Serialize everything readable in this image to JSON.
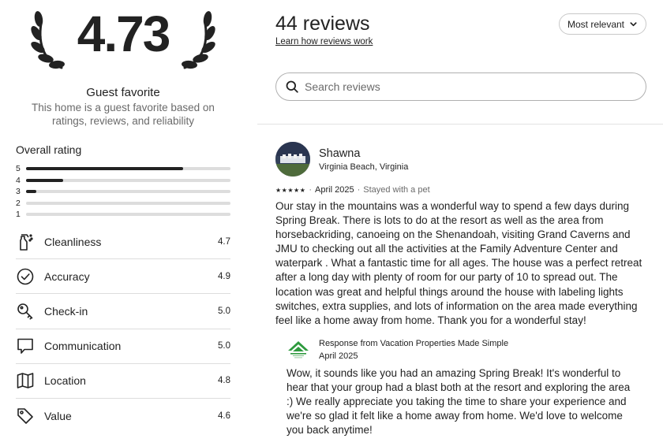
{
  "summary": {
    "overall_score": "4.73",
    "badge_title": "Guest favorite",
    "badge_description": "This home is a guest favorite based on ratings, reviews, and reliability",
    "overall_rating_label": "Overall rating",
    "distribution": [
      {
        "stars": "5",
        "fraction": 0.77
      },
      {
        "stars": "4",
        "fraction": 0.18
      },
      {
        "stars": "3",
        "fraction": 0.05
      },
      {
        "stars": "2",
        "fraction": 0.0
      },
      {
        "stars": "1",
        "fraction": 0.0
      }
    ],
    "categories": [
      {
        "label": "Cleanliness",
        "score": "4.7",
        "icon": "spray-bottle-icon"
      },
      {
        "label": "Accuracy",
        "score": "4.9",
        "icon": "check-circle-icon"
      },
      {
        "label": "Check-in",
        "score": "5.0",
        "icon": "key-icon"
      },
      {
        "label": "Communication",
        "score": "5.0",
        "icon": "chat-bubble-icon"
      },
      {
        "label": "Location",
        "score": "4.8",
        "icon": "map-icon"
      },
      {
        "label": "Value",
        "score": "4.6",
        "icon": "price-tag-icon"
      }
    ]
  },
  "header": {
    "reviews_count": "44 reviews",
    "learn_link": "Learn how reviews work",
    "sort_label": "Most relevant",
    "search_placeholder": "Search reviews"
  },
  "review": {
    "name": "Shawna",
    "location": "Virginia Beach, Virginia",
    "stars": "★★★★★",
    "rating": 5,
    "date": "April 2025",
    "stay_note": "Stayed with a pet",
    "body": "Our stay in the mountains was a wonderful way to spend a few days during Spring Break. There is lots to do at the resort as well as the area from horsebackriding, canoeing on the Shenandoah, visiting Grand Caverns and JMU to checking out all the activities at the Family Adventure Center and waterpark . What a fantastic time for all ages. The house was a perfect retreat after a long day with plenty of room for our party of 10 to spread out. The location was great and helpful things around the house with labeling lights switches, extra supplies, and lots of information on the area made everything feel like a home away from home. Thank you for a wonderful stay!",
    "response": {
      "title": "Response from Vacation Properties Made Simple",
      "date": "April 2025",
      "body": "Wow, it sounds like you had an amazing Spring Break! It's wonderful to hear that your group had a blast both at the resort and exploring the area :) We really appreciate you taking the time to share your experience and we're so glad it felt like a home away from home. We'd love to welcome you back anytime!"
    }
  },
  "colors": {
    "text": "#222222",
    "muted": "#6a6a6a",
    "track": "#dddddd",
    "host_logo_green": "#2e9a3e"
  }
}
